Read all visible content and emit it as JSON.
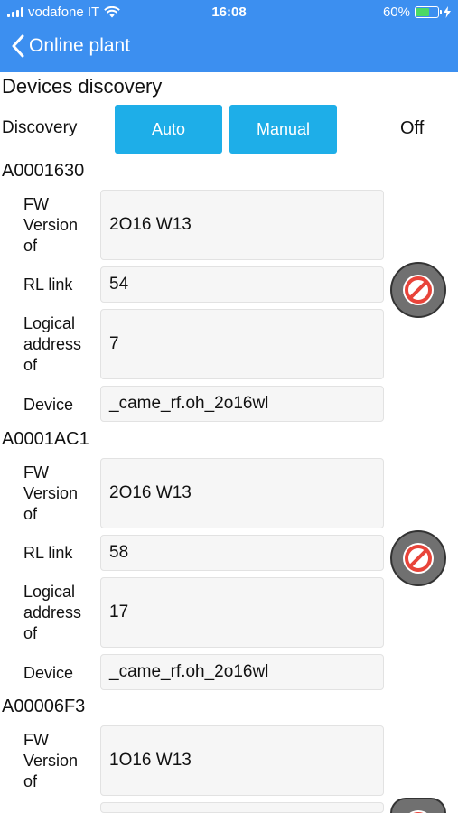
{
  "status_bar": {
    "carrier": "vodafone IT",
    "time": "16:08",
    "battery_percent": "60%",
    "battery_level": 0.6,
    "icons": [
      "signal-icon",
      "wifi-icon",
      "battery-icon",
      "charging-icon"
    ]
  },
  "nav": {
    "back_icon": "chevron-left-icon",
    "title": "Online plant"
  },
  "page": {
    "section_title": "Devices discovery"
  },
  "discovery": {
    "label": "Discovery",
    "auto_label": "Auto",
    "manual_label": "Manual",
    "status": "Off"
  },
  "labels": {
    "fw_line1": "FW",
    "fw_line2": "Version",
    "fw_line3": "of",
    "rl_link": "RL link",
    "logical_line1": "Logical",
    "logical_line2": "address",
    "logical_line3": "of",
    "device": "Device"
  },
  "devices": [
    {
      "id": "A0001630",
      "fw_version": "2O16 W13",
      "rl_link": "54",
      "logical_address": "7",
      "device": "_came_rf.oh_2o16wl"
    },
    {
      "id": "A0001AC1",
      "fw_version": "2O16 W13",
      "rl_link": "58",
      "logical_address": "17",
      "device": "_came_rf.oh_2o16wl"
    },
    {
      "id": "A00006F3",
      "fw_version": "1O16 W13",
      "rl_link": "",
      "logical_address": "",
      "device": ""
    }
  ],
  "colors": {
    "header": "#3c8ff0",
    "button": "#1eaee8",
    "block_button": "#707070",
    "block_icon": "#e8443a"
  }
}
